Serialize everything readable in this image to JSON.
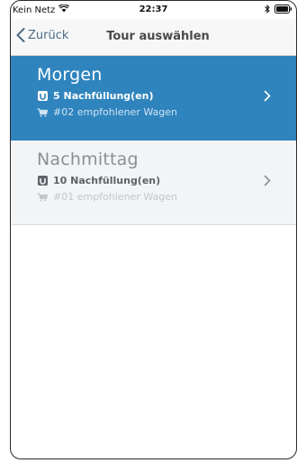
{
  "status_bar": {
    "carrier": "Kein Netz",
    "time": "22:37"
  },
  "nav": {
    "back_label": "Zurück",
    "title": "Tour auswählen"
  },
  "tours": [
    {
      "name": "Morgen",
      "refills": "5 Nachfüllung(en)",
      "cart": "#02 empfohlener Wagen",
      "selected": true
    },
    {
      "name": "Nachmittag",
      "refills": "10 Nachfüllung(en)",
      "cart": "#01 empfohlener Wagen",
      "selected": false
    }
  ],
  "colors": {
    "accent": "#2f84bd",
    "back_link": "#4b6b86",
    "unselected_bg": "#f3f4f6"
  }
}
